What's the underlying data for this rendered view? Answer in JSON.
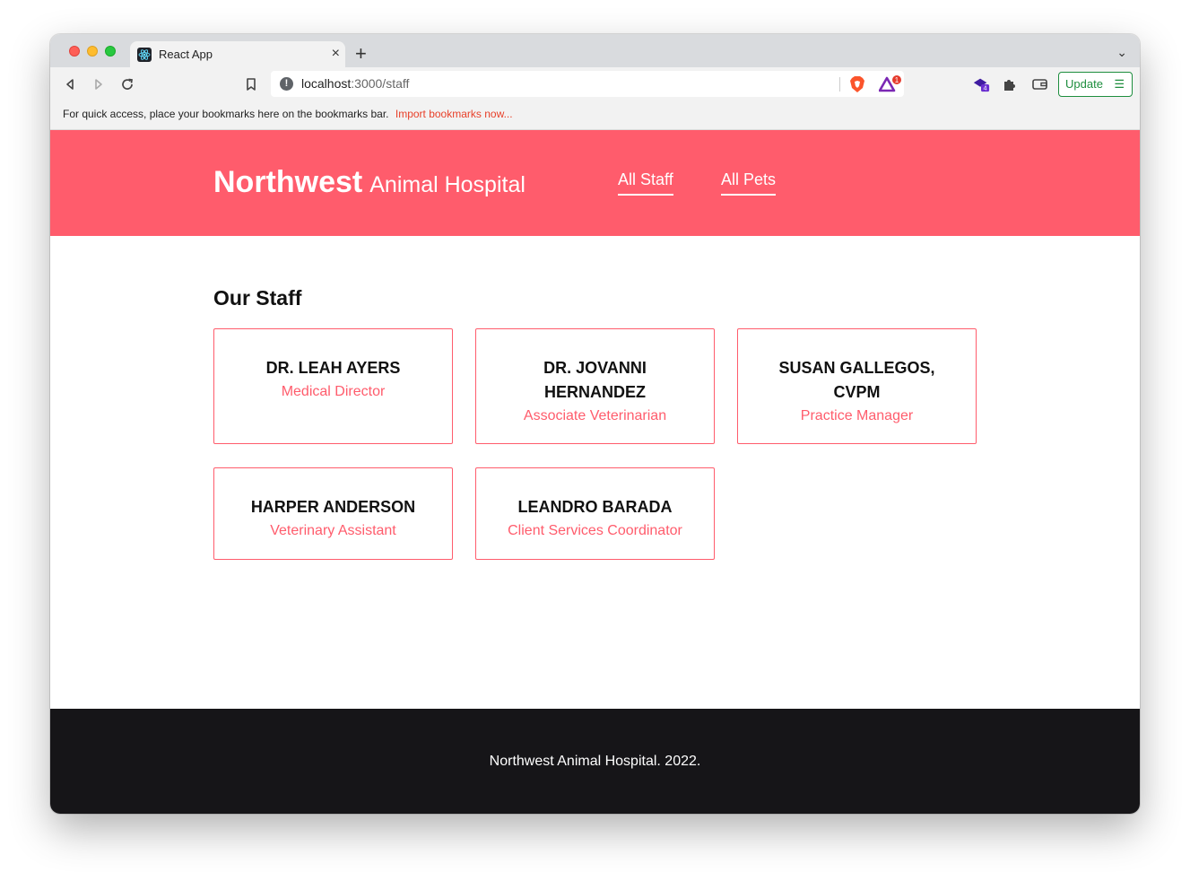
{
  "browser": {
    "tab_title": "React App",
    "tab_close": "×",
    "new_tab": "+",
    "tab_search": "⌄",
    "url_host": "localhost",
    "url_path": ":3000/staff",
    "rewards_badge": "1",
    "wallet_badge": "4",
    "update_label": "Update",
    "update_menu": "☰",
    "bookmarks_text": "For quick access, place your bookmarks here on the bookmarks bar.",
    "bookmarks_link": "Import bookmarks now..."
  },
  "header": {
    "brand_strong": "Northwest",
    "brand_light": "Animal Hospital",
    "nav": [
      {
        "label": "All Staff"
      },
      {
        "label": "All Pets"
      }
    ]
  },
  "main": {
    "title": "Our Staff",
    "staff": [
      {
        "name": "DR. LEAH AYERS",
        "role": "Medical Director"
      },
      {
        "name": "DR. JOVANNI HERNANDEZ",
        "role": "Associate Veterinarian"
      },
      {
        "name": "SUSAN GALLEGOS, CVPM",
        "role": "Practice Manager"
      },
      {
        "name": "HARPER ANDERSON",
        "role": "Veterinary Assistant"
      },
      {
        "name": "LEANDRO BARADA",
        "role": "Client Services Coordinator"
      }
    ]
  },
  "footer": {
    "text": "Northwest Animal Hospital. 2022."
  },
  "colors": {
    "brand": "#ff5c6c",
    "footer_bg": "#161518"
  }
}
